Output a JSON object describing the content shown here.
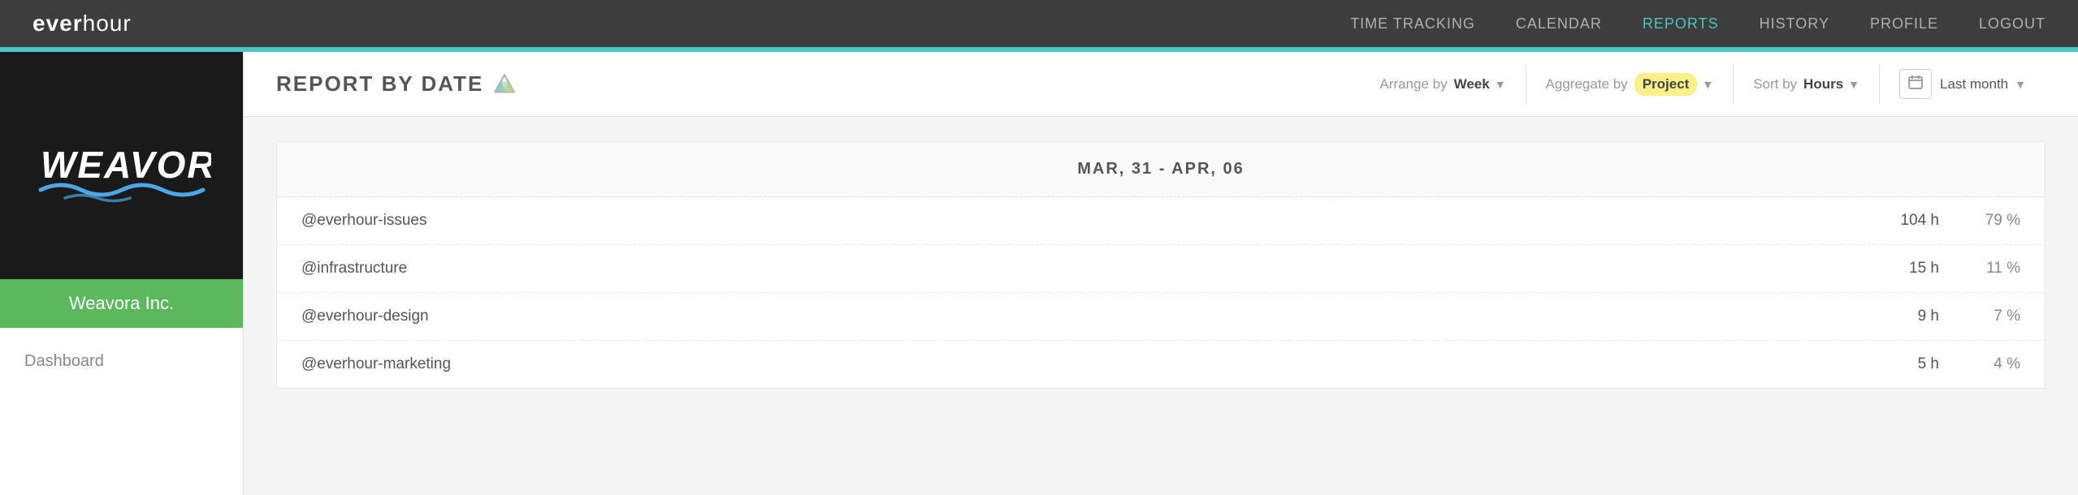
{
  "app": {
    "logo_prefix": "ever",
    "logo_suffix": "hour"
  },
  "nav": {
    "links": [
      {
        "label": "TIME TRACKING",
        "active": false
      },
      {
        "label": "CALENDAR",
        "active": false
      },
      {
        "label": "REPORTS",
        "active": true
      },
      {
        "label": "HISTORY",
        "active": false
      },
      {
        "label": "PROFILE",
        "active": false
      },
      {
        "label": "LOGOUT",
        "active": false
      }
    ]
  },
  "sidebar": {
    "company": "Weavora Inc.",
    "menu_item": "Dashboard"
  },
  "report": {
    "title": "REPORT BY DATE",
    "arrange_label": "Arrange by",
    "arrange_value": "Week",
    "aggregate_label": "Aggregate by",
    "aggregate_value": "Project",
    "sort_label": "Sort by",
    "sort_value": "Hours",
    "date_range": "Last month",
    "week_header": "MAR, 31 - APR, 06",
    "rows": [
      {
        "name": "@everhour-issues",
        "hours": "104 h",
        "percent": "79 %"
      },
      {
        "name": "@infrastructure",
        "hours": "15 h",
        "percent": "11 %"
      },
      {
        "name": "@everhour-design",
        "hours": "9 h",
        "percent": "7 %"
      },
      {
        "name": "@everhour-marketing",
        "hours": "5 h",
        "percent": "4 %"
      }
    ]
  }
}
